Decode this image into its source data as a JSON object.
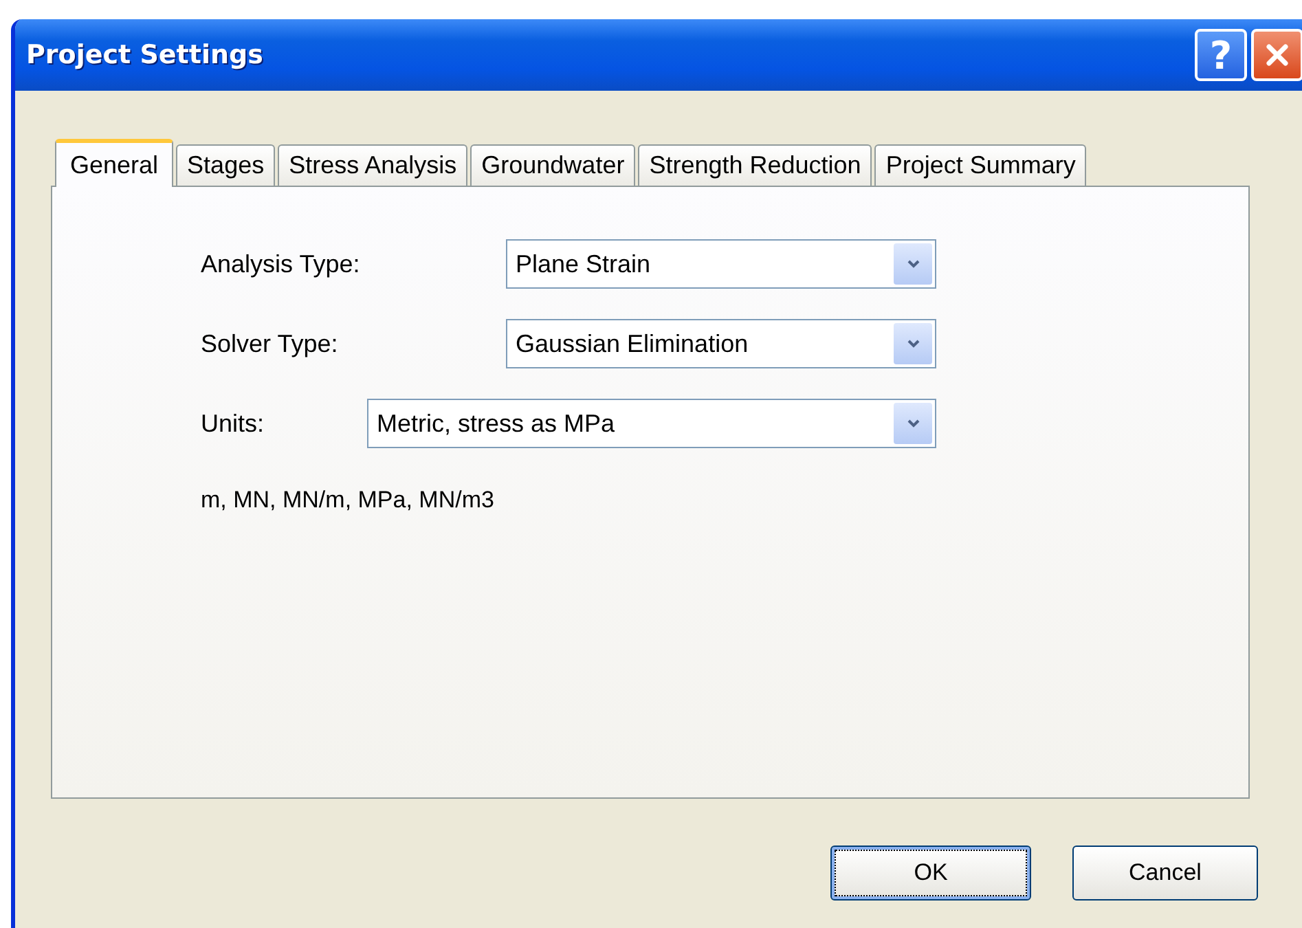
{
  "window": {
    "title": "Project Settings",
    "help_glyph": "?"
  },
  "tabs": [
    {
      "label": "General",
      "selected": true
    },
    {
      "label": "Stages",
      "selected": false
    },
    {
      "label": "Stress Analysis",
      "selected": false
    },
    {
      "label": "Groundwater",
      "selected": false
    },
    {
      "label": "Strength Reduction",
      "selected": false
    },
    {
      "label": "Project Summary",
      "selected": false
    }
  ],
  "fields": [
    {
      "label": "Analysis Type:",
      "value": "Plane Strain",
      "kind": "wide-label"
    },
    {
      "label": "Solver Type:",
      "value": "Gaussian Elimination",
      "kind": "wide-label"
    },
    {
      "label": "Units:",
      "value": "Metric, stress as MPa",
      "kind": "short-label"
    }
  ],
  "units_note": "m, MN, MN/m, MPa, MN/m3",
  "buttons": [
    {
      "label": "OK",
      "default": true
    },
    {
      "label": "Cancel",
      "default": false
    }
  ]
}
